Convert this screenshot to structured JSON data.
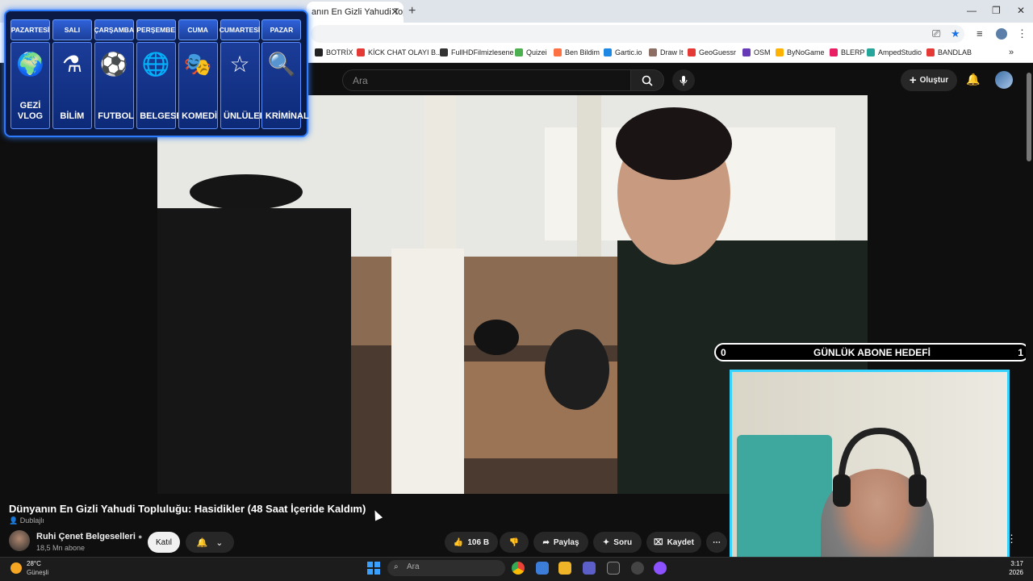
{
  "browser": {
    "tab_title": "anın En Gizli Yahudi Toplul",
    "bookmarks": [
      "BOTRİX",
      "KİCK CHAT OLAYI B...",
      "FullHDFilmizlesene",
      "Quizei",
      "Ben Bildim",
      "Gartic.io",
      "Draw It",
      "GeoGuessr",
      "OSM",
      "ByNoGame",
      "BLERP",
      "AmpedStudio",
      "BANDLAB"
    ],
    "bookmark_colors": [
      "#222222",
      "#e53935",
      "#333333",
      "#4caf50",
      "#ff7043",
      "#1e88e5",
      "#8d6e63",
      "#e53935",
      "#673ab7",
      "#ffb300",
      "#e91e63",
      "#26a69a",
      "#e53935"
    ]
  },
  "youtube": {
    "search_placeholder": "Ara",
    "create_label": "Oluştur",
    "video_title": "Dünyanın En Gizli Yahudi Topluluğu: Hasidikler (48 Saat İçeride Kaldım)",
    "dubbed_label": "Dublajlı",
    "channel_name": "Ruhi Çenet Belgeselleri",
    "channel_subs": "18,5 Mn abone",
    "join_label": "Katıl",
    "like_count": "106 B",
    "share_label": "Paylaş",
    "ask_label": "Soru",
    "save_label": "Kaydet"
  },
  "schedule": {
    "days": [
      "PAZARTESİ",
      "SALI",
      "ÇARŞAMBA",
      "PERŞEMBE",
      "CUMA",
      "CUMARTESİ",
      "PAZAR"
    ],
    "topics": [
      "GEZİ VLOG",
      "BİLİM",
      "FUTBOL",
      "BELGESEL",
      "KOMEDİ",
      "ÜNLÜLER",
      "KRİMİNAL"
    ],
    "icons": [
      "🌍",
      "⚗",
      "⚽",
      "🌐",
      "🎭",
      "☆",
      "🔍"
    ]
  },
  "goal": {
    "title": "GÜNLÜK ABONE HEDEFİ",
    "current": "0",
    "target": "1"
  },
  "taskbar": {
    "temp": "28°C",
    "weather": "Güneşli",
    "search_placeholder": "Ara",
    "time": "3:17",
    "date": "2026"
  }
}
